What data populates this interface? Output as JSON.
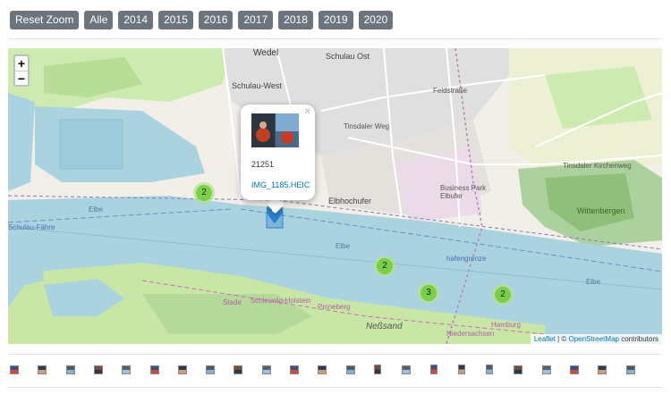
{
  "toolbar": {
    "buttons": [
      {
        "label": "Reset Zoom",
        "name": "reset-zoom-button"
      },
      {
        "label": "Alle",
        "name": "year-all-button"
      },
      {
        "label": "2014",
        "name": "year-2014-button"
      },
      {
        "label": "2015",
        "name": "year-2015-button"
      },
      {
        "label": "2016",
        "name": "year-2016-button"
      },
      {
        "label": "2017",
        "name": "year-2017-button"
      },
      {
        "label": "2018",
        "name": "year-2018-button"
      },
      {
        "label": "2019",
        "name": "year-2019-button"
      },
      {
        "label": "2020",
        "name": "year-2020-button"
      }
    ]
  },
  "map": {
    "zoom_in": "+",
    "zoom_out": "−",
    "clusters": [
      "2",
      "2",
      "3",
      "2"
    ],
    "labels": {
      "wedel": "Wedel",
      "schulau_ost": "Schulau Ost",
      "schulau_west": "Schulau-West",
      "elbhochufer": "Elbhochufer",
      "wittenbergen": "Wittenbergen",
      "elbe1": "Elbe",
      "elbe2": "Elbe",
      "elbe3": "Elbe",
      "nessand": "Neßsand",
      "hamburg": "Hamburg",
      "schulau_faehre": "Schulau-Fähre",
      "tinsdaler_kirchenweg": "Tinsdaler Kirchenweg",
      "tinsdaler_weg": "Tinsdaler Weg",
      "feldstrasse": "Feldstraße",
      "business_park": "Business Park Elbufer",
      "schleswig_holstein": "Schleswig-Holstein",
      "pinneberg": "Pinneberg",
      "stade": "Stade",
      "niedersachsen": "Niedersachsen",
      "hafengrenze": "hafengrenze"
    },
    "popup": {
      "close": "×",
      "number": "21251",
      "link": "IMG_1185.HEIC"
    },
    "attribution": {
      "leaflet": "Leaflet",
      "separator": " | © ",
      "osm": "OpenStreetMap",
      "suffix": " contributors"
    }
  },
  "colors": {
    "button_bg": "#6c757d",
    "water": "#aad3df",
    "land": "#f2efe9",
    "green": "#c8e6a5",
    "forest": "#84b66e",
    "cluster_inner": "#6ecc39",
    "marker": "#2a81cb",
    "link": "#0078a8"
  },
  "thumbnails_count": 23
}
